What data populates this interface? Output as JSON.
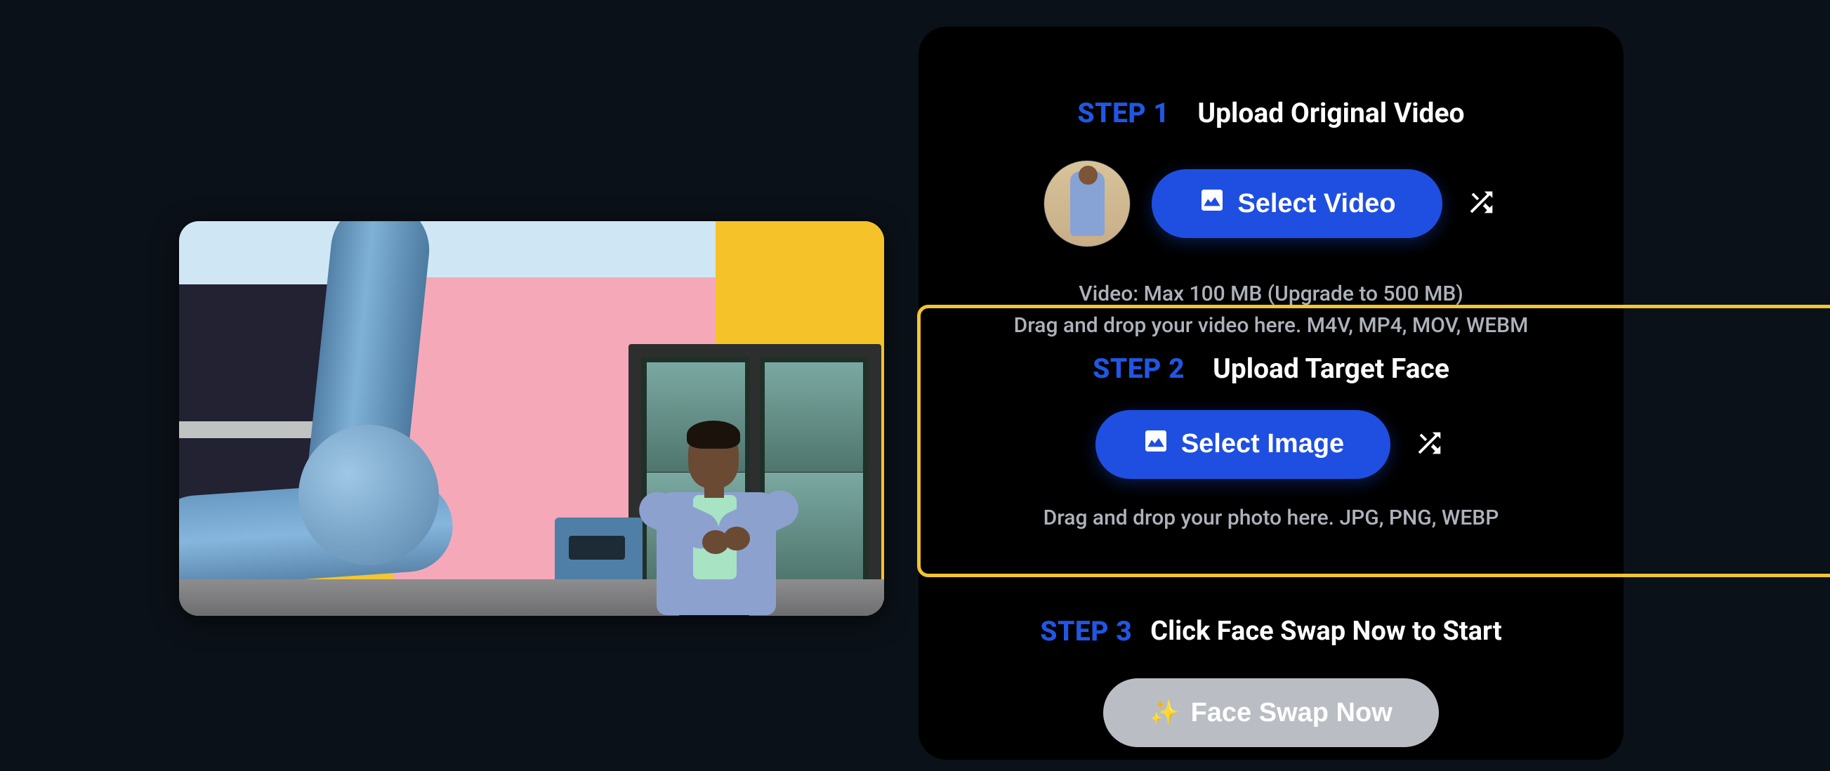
{
  "steps": {
    "one": {
      "label": "STEP 1",
      "title": "Upload Original Video"
    },
    "two": {
      "label": "STEP 2",
      "title": "Upload Target Face"
    },
    "three": {
      "label": "STEP 3",
      "title": "Click Face Swap Now to Start"
    }
  },
  "buttons": {
    "select_video": "Select Video",
    "select_image": "Select Image",
    "face_swap_now": "Face Swap Now"
  },
  "hints": {
    "video_limit": "Video: Max 100 MB (Upgrade to 500 MB)",
    "video_formats": "Drag and drop your video here. M4V, MP4, MOV, WEBM",
    "image_formats": "Drag and drop your photo here. JPG, PNG, WEBP"
  },
  "icons": {
    "image": "image-icon",
    "shuffle": "shuffle-icon",
    "sparkle": "sparkle-icon"
  },
  "colors": {
    "accent": "#1f4fe0",
    "highlight_border": "#f2c531",
    "disabled": "#babdc4",
    "muted_text": "#aeb2bb"
  }
}
